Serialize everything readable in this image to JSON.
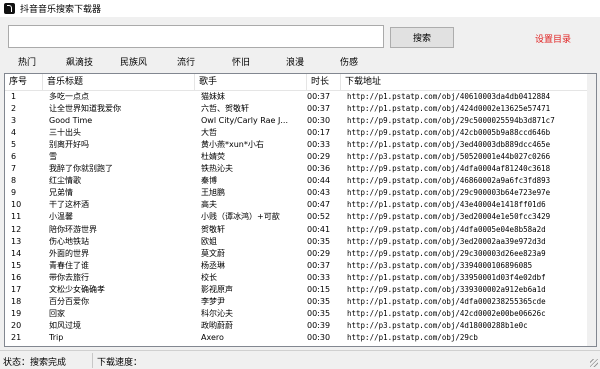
{
  "window": {
    "title": "抖音音乐搜索下载器"
  },
  "search": {
    "value": "",
    "placeholder": "",
    "button_label": "搜索",
    "settings_label": "设置目录"
  },
  "categories": [
    "热门",
    "飙滴技",
    "民族风",
    "流行",
    "怀旧",
    "浪漫",
    "伤感"
  ],
  "table": {
    "headers": [
      "序号",
      "音乐标题",
      "歌手",
      "时长",
      "下载地址"
    ],
    "rows": [
      [
        "1",
        "多吃一点点",
        "猫妹妹",
        "00:37",
        "http://p1.pstatp.com/obj/40610003da4db0412884"
      ],
      [
        "2",
        "让全世界知道我爱你",
        "六哲、贺敬轩",
        "00:37",
        "http://p1.pstatp.com/obj/424d0002e13625e57471"
      ],
      [
        "3",
        "Good Time",
        "Owl City/Carly Rae J...",
        "00:30",
        "http://p9.pstatp.com/obj/29c5000025594b3d871c7"
      ],
      [
        "4",
        "三十出头",
        "大哲",
        "00:17",
        "http://p9.pstatp.com/obj/42cb0005b9a88ccd646b"
      ],
      [
        "5",
        "别离开好吗",
        "黄小燕*xun*小右",
        "00:33",
        "http://p1.pstatp.com/obj/3ed40003db889dcc465e"
      ],
      [
        "6",
        "雪",
        "杜婧荧",
        "00:29",
        "http://p3.pstatp.com/obj/50520001e44b027c0266"
      ],
      [
        "7",
        "我醉了你就别跑了",
        "铁热沁夫",
        "00:36",
        "http://p9.pstatp.com/obj/4dfa0004af81240c3618"
      ],
      [
        "8",
        "红尘情歌",
        "秦博",
        "00:44",
        "http://p9.pstatp.com/obj/46860002a9a6fc3fd893"
      ],
      [
        "9",
        "兄弟情",
        "王旭鹏",
        "00:43",
        "http://p9.pstatp.com/obj/29c900003b64e723e97e"
      ],
      [
        "10",
        "干了这杯酒",
        "高夫",
        "00:47",
        "http://p1.pstatp.com/obj/43e40004e1418ff01d6"
      ],
      [
        "11",
        "小温馨",
        "小贱（谭冰鸿）+可歆",
        "00:52",
        "http://p9.pstatp.com/obj/3ed20004e1e50fcc3429"
      ],
      [
        "12",
        "陪你环游世界",
        "贺敬轩",
        "00:41",
        "http://p9.pstatp.com/obj/4dfa0005e04e8b58a2d"
      ],
      [
        "13",
        "伤心地铁站",
        "欧姐",
        "00:35",
        "http://p9.pstatp.com/obj/3ed20002aa39e972d3d"
      ],
      [
        "14",
        "外面的世界",
        "莫文蔚",
        "00:29",
        "http://p9.pstatp.com/obj/29c300003d26ee823a9"
      ],
      [
        "15",
        "青春住了谁",
        "杨丞琳",
        "00:37",
        "http://p3.pstatp.com/obj/3394000106896085"
      ],
      [
        "16",
        "带你去旅行",
        "校长",
        "00:33",
        "http://p1.pstatp.com/obj/33950001d03f4e02dbf"
      ],
      [
        "17",
        "文松少女确确孝",
        "影视原声",
        "00:15",
        "http://p9.pstatp.com/obj/339300002a912eb6a1d"
      ],
      [
        "18",
        "百分百爱你",
        "李梦尹",
        "00:35",
        "http://p1.pstatp.com/obj/4dfa000238255365cde"
      ],
      [
        "19",
        "回家",
        "科尔沁夫",
        "00:35",
        "http://p1.pstatp.com/obj/42cd0002e00be06626c"
      ],
      [
        "20",
        "如风过境",
        "政哟蔚蔚",
        "00:39",
        "http://p3.pstatp.com/obj/4d18000288b1e0c"
      ],
      [
        "21",
        "Trip",
        "Axero",
        "00:30",
        "http://p1.pstatp.com/obj/29cb"
      ]
    ]
  },
  "status": {
    "label": "状态：搜索完成",
    "speed_label": "下载速度："
  }
}
